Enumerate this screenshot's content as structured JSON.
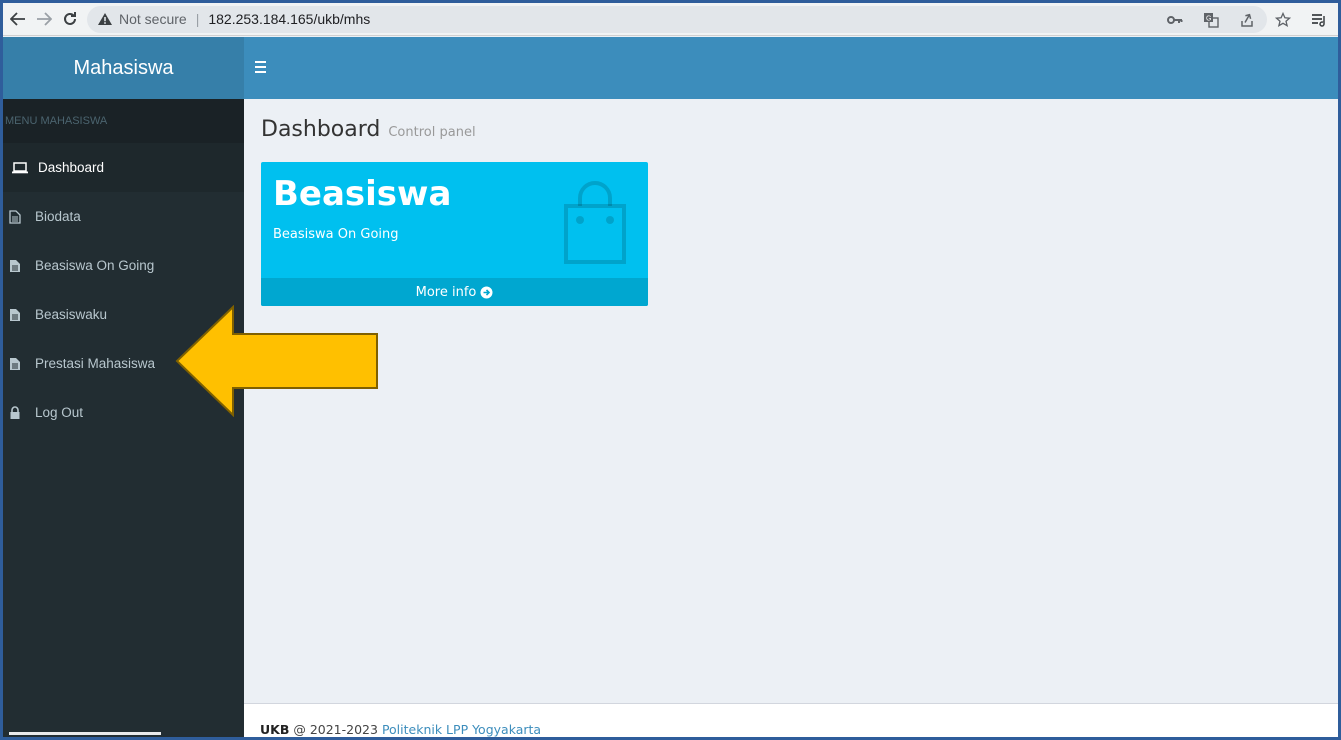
{
  "browser": {
    "security_label": "Not secure",
    "separator": "|",
    "url": "182.253.184.165/ukb/mhs"
  },
  "app": {
    "logo": "Mahasiswa"
  },
  "sidebar": {
    "header": "MENU MAHASISWA",
    "items": [
      {
        "label": "Dashboard",
        "icon": "laptop-icon",
        "active": true
      },
      {
        "label": "Biodata",
        "icon": "file-text-o-icon",
        "active": false
      },
      {
        "label": "Beasiswa On Going",
        "icon": "file-text-icon",
        "active": false
      },
      {
        "label": "Beasiswaku",
        "icon": "file-text-icon",
        "active": false
      },
      {
        "label": "Prestasi Mahasiswa",
        "icon": "file-text-icon",
        "active": false
      },
      {
        "label": "Log Out",
        "icon": "lock-icon",
        "active": false
      }
    ]
  },
  "content": {
    "title": "Dashboard",
    "subtitle": "Control panel",
    "box": {
      "title": "Beasiswa",
      "text": "Beasiswa On Going",
      "footer": "More info",
      "icon": "shopping-bag-icon",
      "color": "#00c0ef",
      "footer_color": "#00a7d0"
    }
  },
  "footer": {
    "brand": "UKB",
    "text": " @ 2021-2023 ",
    "link": "Politeknik LPP Yogyakarta"
  },
  "colors": {
    "header": "#3c8dbc",
    "logo_bg": "#367fa9",
    "sidebar": "#222d32",
    "arrow": "#ffc000"
  }
}
